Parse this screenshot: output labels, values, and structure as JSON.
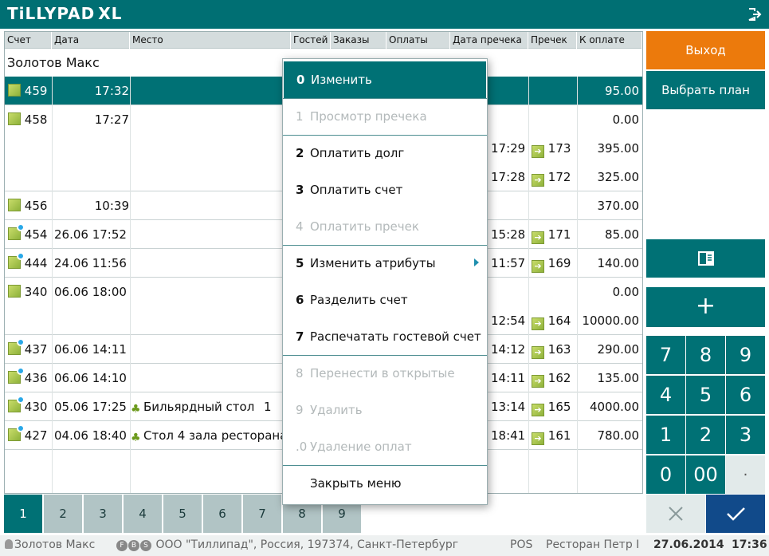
{
  "app": {
    "logo": "TiLLYPAD",
    "logo_suffix": "XL"
  },
  "table": {
    "columns": [
      "Счет",
      "Дата",
      "Место",
      "Гостей",
      "Заказы",
      "Оплаты",
      "Дата пречека",
      "Пречек",
      "К оплате"
    ],
    "group": "Золотов Макс",
    "rows": [
      {
        "icon": "check",
        "account": "459",
        "date": "17:32",
        "place": "",
        "guests": "",
        "precheck_date": "",
        "precheck": "",
        "amount": "95.00",
        "selected": true,
        "sep": true
      },
      {
        "icon": "check",
        "account": "458",
        "date": "17:27",
        "place": "",
        "guests": "",
        "precheck_date": "",
        "precheck": "",
        "amount": "0.00",
        "selected": false,
        "sep": false
      },
      {
        "icon": "",
        "account": "",
        "date": "",
        "place": "",
        "guests": "",
        "precheck_date": "17:29",
        "precheck": "173",
        "amount": "395.00",
        "selected": false,
        "sep": false
      },
      {
        "icon": "",
        "account": "",
        "date": "",
        "place": "",
        "guests": "",
        "precheck_date": "17:28",
        "precheck": "172",
        "amount": "325.00",
        "selected": false,
        "sep": true
      },
      {
        "icon": "check",
        "account": "456",
        "date": "10:39",
        "place": "",
        "guests": "",
        "precheck_date": "",
        "precheck": "",
        "amount": "370.00",
        "selected": false,
        "sep": true
      },
      {
        "icon": "check-dot",
        "account": "454",
        "date": "26.06 17:52",
        "place": "",
        "guests": "",
        "precheck_date": "15:28",
        "precheck": "171",
        "amount": "85.00",
        "selected": false,
        "sep": true
      },
      {
        "icon": "check-dot",
        "account": "444",
        "date": "24.06 11:56",
        "place": "",
        "guests": "",
        "precheck_date": "11:57",
        "precheck": "169",
        "amount": "140.00",
        "selected": false,
        "sep": true
      },
      {
        "icon": "check",
        "account": "340",
        "date": "06.06 18:00",
        "place": "",
        "guests": "",
        "precheck_date": "",
        "precheck": "",
        "amount": "0.00",
        "selected": false,
        "sep": false
      },
      {
        "icon": "",
        "account": "",
        "date": "",
        "place": "",
        "guests": "",
        "precheck_date": "12:54",
        "precheck": "164",
        "amount": "10000.00",
        "selected": false,
        "sep": true
      },
      {
        "icon": "check-dot",
        "account": "437",
        "date": "06.06 14:11",
        "place": "",
        "guests": "",
        "precheck_date": "14:12",
        "precheck": "163",
        "amount": "290.00",
        "selected": false,
        "sep": true
      },
      {
        "icon": "check-dot",
        "account": "436",
        "date": "06.06 14:10",
        "place": "",
        "guests": "",
        "precheck_date": "14:11",
        "precheck": "162",
        "amount": "135.00",
        "selected": false,
        "sep": true
      },
      {
        "icon": "check-dot",
        "account": "430",
        "date": "05.06 17:25",
        "place": "Бильярдный стол",
        "guests": "1",
        "precheck_date": "13:14",
        "precheck": "165",
        "amount": "4000.00",
        "selected": false,
        "sep": true
      },
      {
        "icon": "check-dot",
        "account": "427",
        "date": "04.06 18:40",
        "place": "Стол 4 зала ресторана",
        "guests": "",
        "precheck_date": "18:41",
        "precheck": "161",
        "amount": "780.00",
        "selected": false,
        "sep": true
      }
    ]
  },
  "tabs": [
    "1",
    "2",
    "3",
    "4",
    "5",
    "6",
    "7",
    "8",
    "9"
  ],
  "active_tab": "1",
  "status": {
    "user": "Золотов Макс",
    "badges": [
      "F",
      "B",
      "S"
    ],
    "org": "ООО \"Тиллипад\", Россия, 197374, Санкт-Петербург",
    "mode": "POS",
    "restaurant": "Ресторан Петр I",
    "date": "27.06.2014",
    "time": "17:36"
  },
  "right_panel": {
    "exit_label": "Выход",
    "plan_label": "Выбрать план",
    "plus_label": "+",
    "keys": [
      "7",
      "8",
      "9",
      "4",
      "5",
      "6",
      "1",
      "2",
      "3",
      "0",
      "00",
      "."
    ]
  },
  "menu": {
    "items": [
      {
        "key": "0",
        "label": "Изменить",
        "state": "active"
      },
      {
        "key": "1",
        "label": "Просмотр пречека",
        "state": "disabled"
      },
      {
        "key": "2",
        "label": "Оплатить долг",
        "state": "enabled"
      },
      {
        "key": "3",
        "label": "Оплатить счет",
        "state": "enabled"
      },
      {
        "key": "4",
        "label": "Оплатить пречек",
        "state": "disabled"
      },
      {
        "key": "5",
        "label": "Изменить атрибуты",
        "state": "enabled",
        "submenu": true
      },
      {
        "key": "6",
        "label": "Разделить счет",
        "state": "enabled"
      },
      {
        "key": "7",
        "label": "Распечатать гостевой счет",
        "state": "enabled"
      },
      {
        "key": "8",
        "label": "Перенести в открытые",
        "state": "disabled"
      },
      {
        "key": "9",
        "label": "Удалить",
        "state": "disabled"
      },
      {
        "key": ".0",
        "label": "Удаление оплат",
        "state": "disabled"
      },
      {
        "key": "",
        "label": "Закрыть меню",
        "state": "enabled"
      }
    ]
  },
  "colors": {
    "teal": "#007175",
    "orange": "#ec7a0c",
    "navy": "#114a8a"
  }
}
